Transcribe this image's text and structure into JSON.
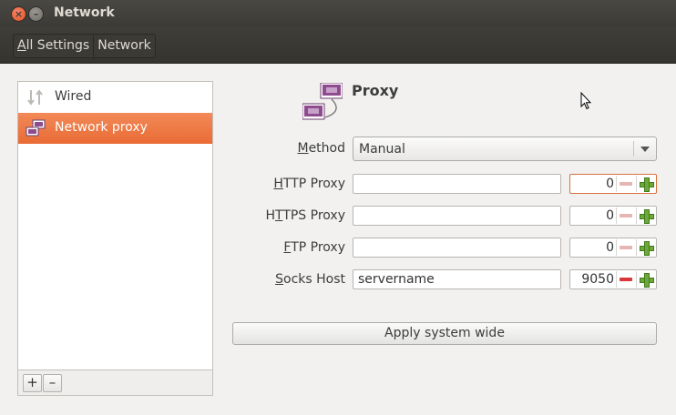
{
  "window": {
    "title": "Network",
    "close_glyph": "×",
    "minimize_glyph": "–"
  },
  "toolbar": {
    "breadcrumbs": [
      {
        "accel": "A",
        "rest": "ll Settings"
      },
      {
        "label": "Network"
      }
    ]
  },
  "sidebar": {
    "items": [
      {
        "label": "Wired",
        "icon": "wired-arrows-icon"
      },
      {
        "label": "Network proxy",
        "icon": "network-proxy-icon",
        "selected": true
      }
    ],
    "add_label": "+",
    "remove_label": "–"
  },
  "panel": {
    "title": "Proxy",
    "method": {
      "accel": "M",
      "rest": "ethod",
      "value": "Manual"
    },
    "rows": [
      {
        "label_pre": "",
        "accel": "H",
        "label_post": "TTP Proxy",
        "host": "",
        "port": "0"
      },
      {
        "label_pre": "H",
        "accel": "T",
        "label_post": "TPS Proxy",
        "host": "",
        "port": "0"
      },
      {
        "label_pre": "",
        "accel": "F",
        "label_post": "TP Proxy",
        "host": "",
        "port": "0"
      },
      {
        "label_pre": "",
        "accel": "S",
        "label_post": "ocks Host",
        "host": "servername",
        "port": "9050"
      }
    ],
    "apply_label": "Apply system wide"
  },
  "colors": {
    "accent": "#e96b35",
    "titlebar": "#3c3b37",
    "plus_green": "#6fa83a",
    "minus_red": "#d9363a"
  }
}
